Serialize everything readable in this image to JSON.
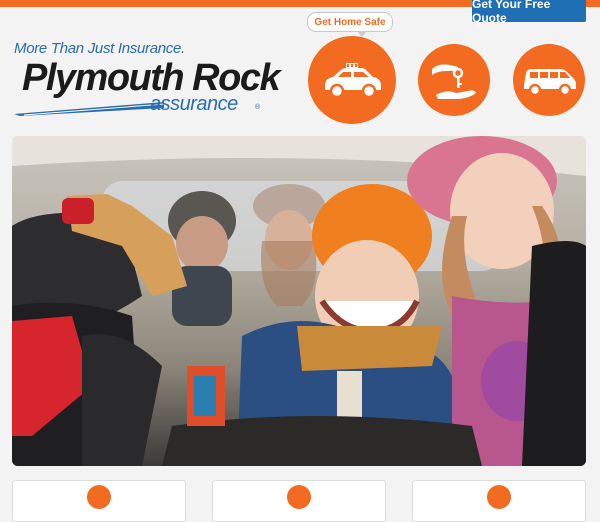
{
  "header": {
    "quote_button": "Get Your Free Quote",
    "tagline": "More Than Just Insurance.",
    "logo_main": "Plymouth Rock",
    "logo_sub": "assurance",
    "logo_reg": "®"
  },
  "services": {
    "callout": "Get Home Safe",
    "items": [
      {
        "icon": "taxi-icon"
      },
      {
        "icon": "key-handoff-icon"
      },
      {
        "icon": "minivan-icon"
      }
    ]
  },
  "hero": {
    "subject": "family-in-car-photo"
  },
  "cards": [
    {
      "icon": "orange-circle-icon"
    },
    {
      "icon": "orange-circle-icon"
    },
    {
      "icon": "orange-circle-icon"
    }
  ],
  "colors": {
    "accent": "#f26b21",
    "brand_blue": "#1f6fb5",
    "text_dark": "#1b1b1b",
    "background": "#f3f3f3"
  }
}
